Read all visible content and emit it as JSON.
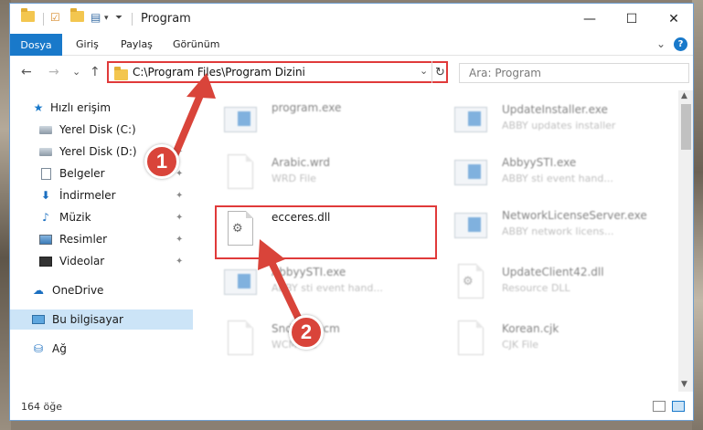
{
  "window": {
    "title": "Program",
    "controls": {
      "minimize": "—",
      "maximize": "☐",
      "close": "✕"
    }
  },
  "ribbon": {
    "tabs": [
      {
        "label": "Dosya"
      },
      {
        "label": "Giriş"
      },
      {
        "label": "Paylaş"
      },
      {
        "label": "Görünüm"
      }
    ],
    "expand": "⌄",
    "help": "?"
  },
  "nav": {
    "back": "←",
    "forward": "→",
    "recent": "⌄",
    "up": "↑"
  },
  "address": {
    "path": "C:\\Program Files\\Program Dizini",
    "dropdown": "⌄",
    "refresh": "↻"
  },
  "search": {
    "placeholder": "Ara: Program"
  },
  "sidebar": {
    "items": [
      {
        "label": "Hızlı erişim",
        "icon": "star-icon"
      },
      {
        "label": "Yerel Disk (C:)",
        "icon": "disk-icon"
      },
      {
        "label": "Yerel Disk (D:)",
        "icon": "disk-icon"
      },
      {
        "label": "Belgeler",
        "icon": "document-icon"
      },
      {
        "label": "İndirmeler",
        "icon": "download-icon"
      },
      {
        "label": "Müzik",
        "icon": "music-icon"
      },
      {
        "label": "Resimler",
        "icon": "pictures-icon"
      },
      {
        "label": "Videolar",
        "icon": "videos-icon"
      },
      {
        "label": "OneDrive",
        "icon": "cloud-icon"
      },
      {
        "label": "Bu bilgisayar",
        "icon": "computer-icon"
      },
      {
        "label": "Ağ",
        "icon": "network-icon"
      }
    ],
    "pin": "📌"
  },
  "files": [
    {
      "name": "program.exe",
      "desc": "",
      "icon": "application-icon"
    },
    {
      "name": "UpdateInstaller.exe",
      "desc": "ABBY updates installer",
      "icon": "application-icon"
    },
    {
      "name": "Arabic.wrd",
      "desc": "WRD File",
      "icon": "file-icon"
    },
    {
      "name": "AbbyySTI.exe",
      "desc": "ABBY sti event hand...",
      "icon": "application-icon"
    },
    {
      "name": "ecceres.dll",
      "desc": "",
      "icon": "dll-gear-icon"
    },
    {
      "name": "NetworkLicenseServer.exe",
      "desc": "ABBY network licens...",
      "icon": "application-icon"
    },
    {
      "name": "AbbyySTI.exe",
      "desc": "ABBY sti event hand...",
      "icon": "application-icon"
    },
    {
      "name": "UpdateClient42.dll",
      "desc": "Resource DLL",
      "icon": "dll-gear-icon"
    },
    {
      "name": "SndTo...wcm",
      "desc": "WCM File",
      "icon": "file-icon"
    },
    {
      "name": "Korean.cjk",
      "desc": "CJK File",
      "icon": "file-icon"
    }
  ],
  "status": {
    "count": "164 öğe"
  },
  "annotations": {
    "badge1": "1",
    "badge2": "2",
    "accent": "#d9443a"
  }
}
